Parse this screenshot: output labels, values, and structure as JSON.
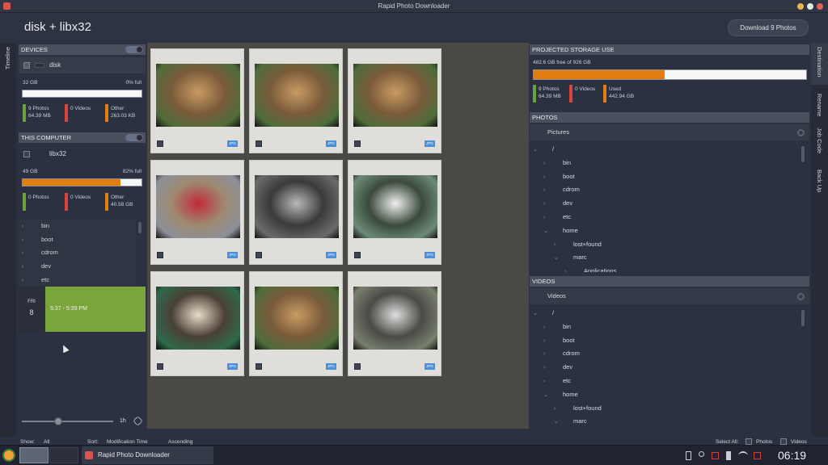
{
  "window": {
    "title": "Rapid Photo Downloader"
  },
  "header": {
    "title": "disk + libx32",
    "download_label": "Download 9 Photos"
  },
  "left_tabs": {
    "timeline": "Timeline"
  },
  "right_tabs": {
    "destination": "Destination",
    "rename": "Rename",
    "job_code": "Job Code",
    "back_up": "Back Up"
  },
  "devices": {
    "header": "DEVICES",
    "name": "disk",
    "capacity": "32 GB",
    "full": "0% full",
    "fill_percent": 0,
    "photos_label": "9 Photos",
    "photos_size": "64.39 MB",
    "videos_label": "0 Videos",
    "other_label": "Other",
    "other_size": "263.03 KB"
  },
  "this_computer": {
    "header": "THIS COMPUTER",
    "name": "libx32",
    "capacity": "49 GB",
    "full": "82% full",
    "fill_percent": 82,
    "photos_label": "0 Photos",
    "videos_label": "0 Videos",
    "other_label": "Other",
    "other_size": "40.58 GB",
    "tree": [
      "bin",
      "boot",
      "cdrom",
      "dev",
      "etc"
    ]
  },
  "timeline": {
    "day": "FRI",
    "date": "8",
    "range": "5:37 - 5:39 PM",
    "scale": "1h"
  },
  "thumbnails": [
    {
      "type": "JPG",
      "subject": "dog"
    },
    {
      "type": "JPG",
      "subject": "dog"
    },
    {
      "type": "JPG",
      "subject": "dog"
    },
    {
      "type": "JPG",
      "subject": "teddy-heart"
    },
    {
      "type": "JPG",
      "subject": "frame"
    },
    {
      "type": "JPG",
      "subject": "orchid"
    },
    {
      "type": "JPG",
      "subject": "teddy"
    },
    {
      "type": "JPG",
      "subject": "dog"
    },
    {
      "type": "JPG",
      "subject": "flower"
    }
  ],
  "storage": {
    "header": "PROJECTED STORAGE USE",
    "free": "482.6 GB free of 926 GB",
    "fill_percent": 48,
    "photos_label": "9 Photos",
    "photos_size": "64.39 MB",
    "videos_label": "0 Videos",
    "used_label": "Used",
    "used_size": "442.94 GB"
  },
  "photos": {
    "header": "PHOTOS",
    "folder": "Pictures",
    "tree": [
      {
        "label": "/",
        "indent": 0,
        "open": true
      },
      {
        "label": "bin",
        "indent": 1
      },
      {
        "label": "boot",
        "indent": 1
      },
      {
        "label": "cdrom",
        "indent": 1
      },
      {
        "label": "dev",
        "indent": 1
      },
      {
        "label": "etc",
        "indent": 1
      },
      {
        "label": "home",
        "indent": 1,
        "open": true
      },
      {
        "label": "lost+found",
        "indent": 2
      },
      {
        "label": "marc",
        "indent": 2,
        "open": true
      },
      {
        "label": "Applications",
        "indent": 3
      }
    ]
  },
  "videos": {
    "header": "VIDEOS",
    "folder": "Videos",
    "tree": [
      {
        "label": "/",
        "indent": 0,
        "open": true
      },
      {
        "label": "bin",
        "indent": 1
      },
      {
        "label": "boot",
        "indent": 1
      },
      {
        "label": "cdrom",
        "indent": 1
      },
      {
        "label": "dev",
        "indent": 1
      },
      {
        "label": "etc",
        "indent": 1
      },
      {
        "label": "home",
        "indent": 1,
        "open": true
      },
      {
        "label": "lost+found",
        "indent": 2
      },
      {
        "label": "marc",
        "indent": 2,
        "open": true
      }
    ]
  },
  "bottom": {
    "show_label": "Show:",
    "show_value": "All",
    "sort_label": "Sort:",
    "sort_value": "Modification Time",
    "order": "Ascending",
    "select_all": "Select All:",
    "photos": "Photos",
    "videos": "Videos"
  },
  "taskbar": {
    "app": "Rapid Photo Downloader",
    "clock": "06:19"
  },
  "colors": {
    "photos": "#6aa33a",
    "videos": "#d9433a",
    "other": "#e27d10",
    "timeline": "#7aa53a"
  }
}
